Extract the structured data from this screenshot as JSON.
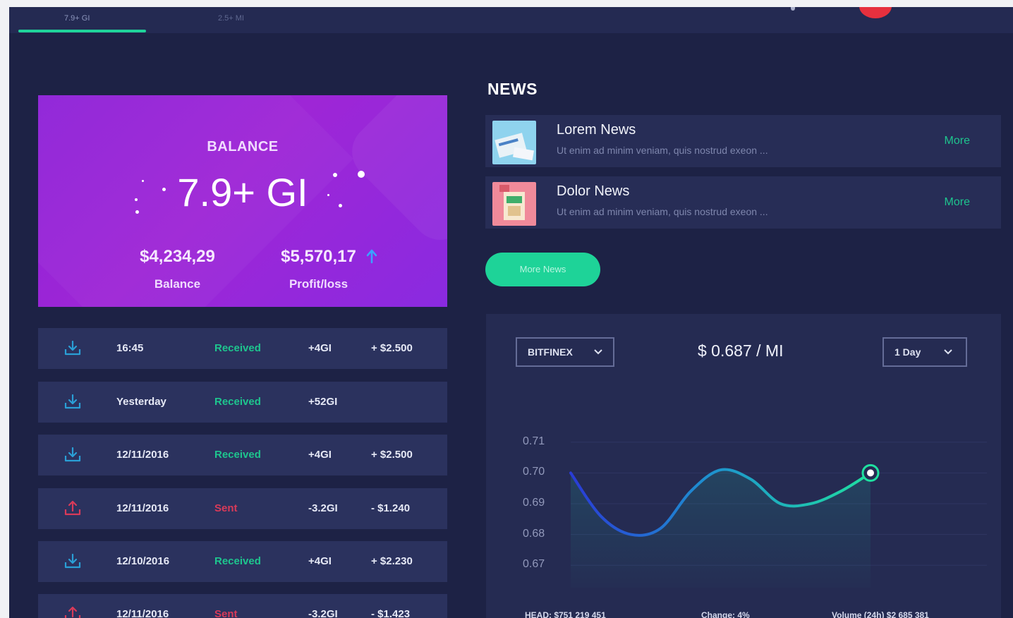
{
  "top_tabs": [
    "7.9+ GI",
    "2.5+ MI"
  ],
  "balance_card": {
    "title": "BALANCE",
    "amount": "7.9+ GI",
    "balance_value": "$4,234,29",
    "balance_label": "Balance",
    "profit_value": "$5,570,17",
    "profit_label": "Profit/loss"
  },
  "transactions": [
    {
      "icon": "download-icon",
      "time": "16:45",
      "status": "Received",
      "amount": "+4GI",
      "usd": "+ $2.500"
    },
    {
      "icon": "download-icon",
      "time": "Yesterday",
      "status": "Received",
      "amount": "+52GI",
      "usd": ""
    },
    {
      "icon": "download-icon",
      "time": "12/11/2016",
      "status": "Received",
      "amount": "+4GI",
      "usd": "+ $2.500"
    },
    {
      "icon": "upload-icon",
      "time": "12/11/2016",
      "status": "Sent",
      "amount": "-3.2GI",
      "usd": "- $1.240"
    },
    {
      "icon": "download-icon",
      "time": "12/10/2016",
      "status": "Received",
      "amount": "+4GI",
      "usd": "+ $2.230"
    },
    {
      "icon": "upload-icon",
      "time": "12/11/2016",
      "status": "Sent",
      "amount": "-3.2GI",
      "usd": "- $1.423"
    }
  ],
  "news": {
    "title": "NEWS",
    "items": [
      {
        "headline": "Lorem News",
        "text": "Ut enim ad minim veniam, quis nostrud exeon ...",
        "more": "More"
      },
      {
        "headline": "Dolor News",
        "text": "Ut enim ad minim veniam, quis nostrud exeon ...",
        "more": "More"
      }
    ],
    "more_button": "More News"
  },
  "chart_panel": {
    "exchange": "BITFINEX",
    "price": "$ 0.687 / MI",
    "period": "1 Day",
    "footer": [
      "HEAD: $751 219 451",
      "Change: 4%",
      "Volume (24h) $2 685 381"
    ]
  },
  "colors": {
    "background": "#1d2245",
    "accent": "#1ed398",
    "card_purple": "#9a25d8",
    "sent_red": "#d83a59",
    "line_start": "#2a3bd6",
    "line_end": "#1fe0a0"
  },
  "chart_data": {
    "type": "line",
    "ylim": [
      0.665,
      0.715
    ],
    "yticks": [
      "0.71",
      "0.70",
      "0.69",
      "0.68",
      "0.67"
    ],
    "ytick_values": [
      0.71,
      0.7,
      0.69,
      0.68,
      0.67
    ],
    "x": [
      0,
      1,
      2,
      3,
      4,
      5,
      6,
      7,
      8,
      9,
      10
    ],
    "values": [
      0.7,
      0.686,
      0.68,
      0.682,
      0.694,
      0.701,
      0.698,
      0.69,
      0.69,
      0.694,
      0.7
    ],
    "grid": true,
    "legend": "none"
  }
}
